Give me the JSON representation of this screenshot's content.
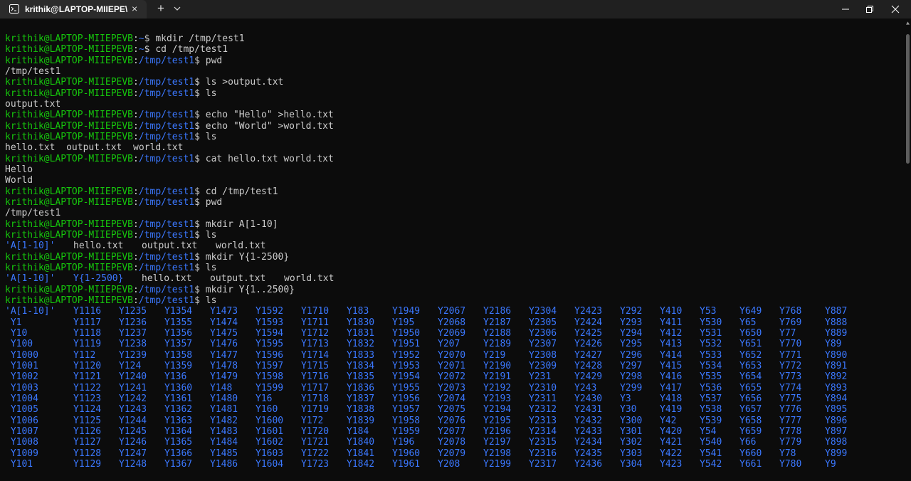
{
  "window": {
    "tab_title": "krithik@LAPTOP-MIIEPE\\",
    "tab_close": "×",
    "new_tab": "+"
  },
  "prompt": {
    "user": "krithik@LAPTOP-MIIEPEVB",
    "colon": ":",
    "dollar": "$"
  },
  "history": [
    {
      "type": "prompt",
      "path": "~",
      "cmd": " mkdir /tmp/test1"
    },
    {
      "type": "prompt",
      "path": "~",
      "cmd": " cd /tmp/test1"
    },
    {
      "type": "prompt",
      "path": "/tmp/test1",
      "cmd": " pwd"
    },
    {
      "type": "output",
      "text": "/tmp/test1"
    },
    {
      "type": "prompt",
      "path": "/tmp/test1",
      "cmd": " ls >output.txt"
    },
    {
      "type": "prompt",
      "path": "/tmp/test1",
      "cmd": " ls"
    },
    {
      "type": "output",
      "text": "output.txt"
    },
    {
      "type": "prompt",
      "path": "/tmp/test1",
      "cmd": " echo \"Hello\" >hello.txt"
    },
    {
      "type": "prompt",
      "path": "/tmp/test1",
      "cmd": " echo \"World\" >world.txt"
    },
    {
      "type": "prompt",
      "path": "/tmp/test1",
      "cmd": " ls"
    },
    {
      "type": "output",
      "text": "hello.txt  output.txt  world.txt"
    },
    {
      "type": "prompt",
      "path": "/tmp/test1",
      "cmd": " cat hello.txt world.txt"
    },
    {
      "type": "output",
      "text": "Hello"
    },
    {
      "type": "output",
      "text": "World"
    },
    {
      "type": "prompt",
      "path": "/tmp/test1",
      "cmd": " cd /tmp/test1"
    },
    {
      "type": "prompt",
      "path": "/tmp/test1",
      "cmd": " pwd"
    },
    {
      "type": "output",
      "text": "/tmp/test1"
    },
    {
      "type": "prompt",
      "path": "/tmp/test1",
      "cmd": " mkdir A[1-10]"
    },
    {
      "type": "prompt",
      "path": "/tmp/test1",
      "cmd": " ls"
    },
    {
      "type": "ls",
      "items": [
        {
          "t": "'A[1-10]'",
          "dir": true,
          "col": 0
        },
        {
          "t": "hello.txt",
          "dir": false,
          "col": 12
        },
        {
          "t": "output.txt",
          "dir": false,
          "col": 24
        },
        {
          "t": "world.txt",
          "dir": false,
          "col": 37
        }
      ]
    },
    {
      "type": "prompt",
      "path": "/tmp/test1",
      "cmd": " mkdir Y{1-2500}"
    },
    {
      "type": "prompt",
      "path": "/tmp/test1",
      "cmd": " ls"
    },
    {
      "type": "ls",
      "items": [
        {
          "t": "'A[1-10]'",
          "dir": true,
          "col": 0
        },
        {
          "t": "Y{1-2500}",
          "dir": true,
          "col": 12
        },
        {
          "t": "hello.txt",
          "dir": false,
          "col": 24
        },
        {
          "t": "output.txt",
          "dir": false,
          "col": 36
        },
        {
          "t": "world.txt",
          "dir": false,
          "col": 49
        }
      ]
    },
    {
      "type": "prompt",
      "path": "/tmp/test1",
      "cmd": " mkdir Y{1..2500}"
    },
    {
      "type": "prompt",
      "path": "/tmp/test1",
      "cmd": " ls"
    }
  ],
  "listing_columns": [
    0,
    12,
    20,
    28,
    36,
    44,
    52,
    60,
    68,
    76,
    84,
    92,
    100,
    108,
    115,
    122,
    129,
    136
  ],
  "listing": [
    [
      "'A[1-10]'",
      "Y1116",
      "Y1235",
      "Y1354",
      "Y1473",
      "Y1592",
      "Y1710",
      "Y183",
      "Y1949",
      "Y2067",
      "Y2186",
      "Y2304",
      "Y2423",
      "Y292",
      "Y410",
      "Y53",
      "Y649",
      "Y768",
      "Y887"
    ],
    [
      " Y1",
      "Y1117",
      "Y1236",
      "Y1355",
      "Y1474",
      "Y1593",
      "Y1711",
      "Y1830",
      "Y195",
      "Y2068",
      "Y2187",
      "Y2305",
      "Y2424",
      "Y293",
      "Y411",
      "Y530",
      "Y65",
      "Y769",
      "Y888"
    ],
    [
      " Y10",
      "Y1118",
      "Y1237",
      "Y1356",
      "Y1475",
      "Y1594",
      "Y1712",
      "Y1831",
      "Y1950",
      "Y2069",
      "Y2188",
      "Y2306",
      "Y2425",
      "Y294",
      "Y412",
      "Y531",
      "Y650",
      "Y77",
      "Y889"
    ],
    [
      " Y100",
      "Y1119",
      "Y1238",
      "Y1357",
      "Y1476",
      "Y1595",
      "Y1713",
      "Y1832",
      "Y1951",
      "Y207",
      "Y2189",
      "Y2307",
      "Y2426",
      "Y295",
      "Y413",
      "Y532",
      "Y651",
      "Y770",
      "Y89"
    ],
    [
      " Y1000",
      "Y112",
      "Y1239",
      "Y1358",
      "Y1477",
      "Y1596",
      "Y1714",
      "Y1833",
      "Y1952",
      "Y2070",
      "Y219",
      "Y2308",
      "Y2427",
      "Y296",
      "Y414",
      "Y533",
      "Y652",
      "Y771",
      "Y890"
    ],
    [
      " Y1001",
      "Y1120",
      "Y124",
      "Y1359",
      "Y1478",
      "Y1597",
      "Y1715",
      "Y1834",
      "Y1953",
      "Y2071",
      "Y2190",
      "Y2309",
      "Y2428",
      "Y297",
      "Y415",
      "Y534",
      "Y653",
      "Y772",
      "Y891"
    ],
    [
      " Y1002",
      "Y1121",
      "Y1240",
      "Y136",
      "Y1479",
      "Y1598",
      "Y1716",
      "Y1835",
      "Y1954",
      "Y2072",
      "Y2191",
      "Y231",
      "Y2429",
      "Y298",
      "Y416",
      "Y535",
      "Y654",
      "Y773",
      "Y892"
    ],
    [
      " Y1003",
      "Y1122",
      "Y1241",
      "Y1360",
      "Y148",
      "Y1599",
      "Y1717",
      "Y1836",
      "Y1955",
      "Y2073",
      "Y2192",
      "Y2310",
      "Y243",
      "Y299",
      "Y417",
      "Y536",
      "Y655",
      "Y774",
      "Y893"
    ],
    [
      " Y1004",
      "Y1123",
      "Y1242",
      "Y1361",
      "Y1480",
      "Y16",
      "Y1718",
      "Y1837",
      "Y1956",
      "Y2074",
      "Y2193",
      "Y2311",
      "Y2430",
      "Y3",
      "Y418",
      "Y537",
      "Y656",
      "Y775",
      "Y894"
    ],
    [
      " Y1005",
      "Y1124",
      "Y1243",
      "Y1362",
      "Y1481",
      "Y160",
      "Y1719",
      "Y1838",
      "Y1957",
      "Y2075",
      "Y2194",
      "Y2312",
      "Y2431",
      "Y30",
      "Y419",
      "Y538",
      "Y657",
      "Y776",
      "Y895"
    ],
    [
      " Y1006",
      "Y1125",
      "Y1244",
      "Y1363",
      "Y1482",
      "Y1600",
      "Y172",
      "Y1839",
      "Y1958",
      "Y2076",
      "Y2195",
      "Y2313",
      "Y2432",
      "Y300",
      "Y42",
      "Y539",
      "Y658",
      "Y777",
      "Y896"
    ],
    [
      " Y1007",
      "Y1126",
      "Y1245",
      "Y1364",
      "Y1483",
      "Y1601",
      "Y1720",
      "Y184",
      "Y1959",
      "Y2077",
      "Y2196",
      "Y2314",
      "Y2433",
      "Y301",
      "Y420",
      "Y54",
      "Y659",
      "Y778",
      "Y897"
    ],
    [
      " Y1008",
      "Y1127",
      "Y1246",
      "Y1365",
      "Y1484",
      "Y1602",
      "Y1721",
      "Y1840",
      "Y196",
      "Y2078",
      "Y2197",
      "Y2315",
      "Y2434",
      "Y302",
      "Y421",
      "Y540",
      "Y66",
      "Y779",
      "Y898"
    ],
    [
      " Y1009",
      "Y1128",
      "Y1247",
      "Y1366",
      "Y1485",
      "Y1603",
      "Y1722",
      "Y1841",
      "Y1960",
      "Y2079",
      "Y2198",
      "Y2316",
      "Y2435",
      "Y303",
      "Y422",
      "Y541",
      "Y660",
      "Y78",
      "Y899"
    ],
    [
      " Y101",
      "Y1129",
      "Y1248",
      "Y1367",
      "Y1486",
      "Y1604",
      "Y1723",
      "Y1842",
      "Y1961",
      "Y208",
      "Y2199",
      "Y2317",
      "Y2436",
      "Y304",
      "Y423",
      "Y542",
      "Y661",
      "Y780",
      "Y9"
    ]
  ],
  "colors": {
    "background": "#0c0c0c",
    "user": "#16c60c",
    "path": "#3b78ff",
    "text": "#cccccc",
    "titlebar": "#202020"
  }
}
